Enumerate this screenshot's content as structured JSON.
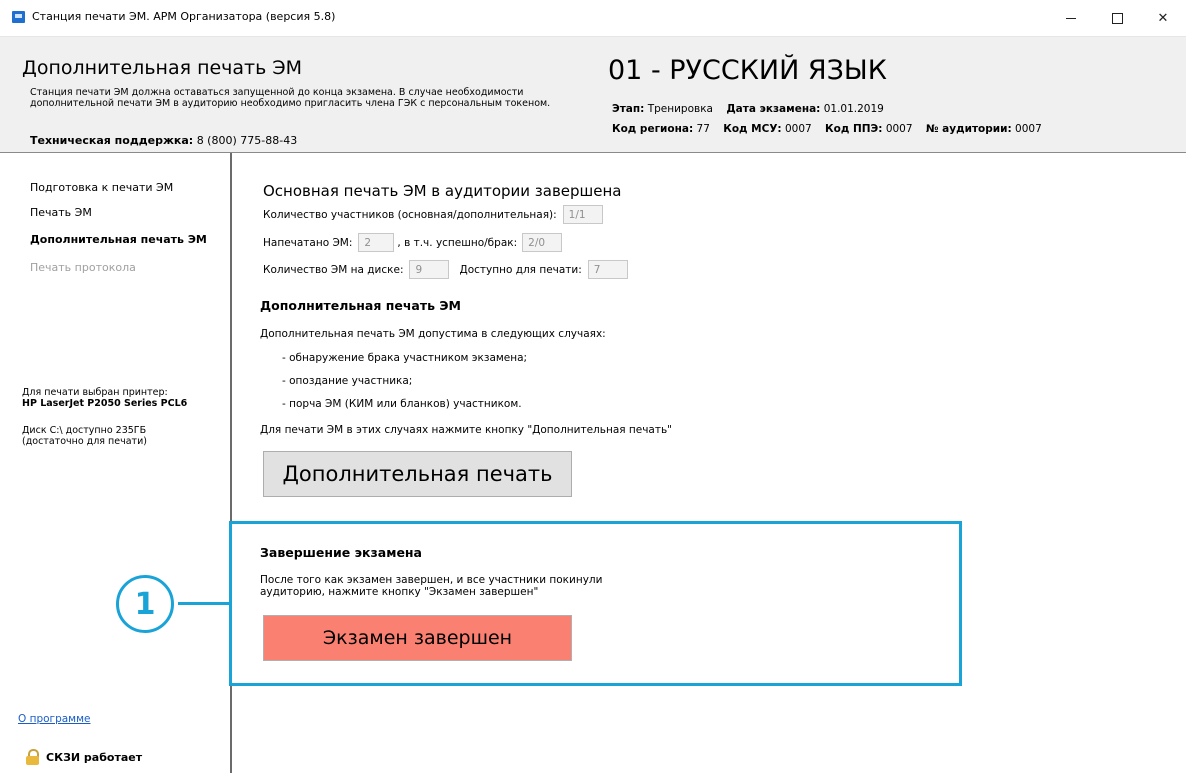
{
  "window": {
    "title": "Станция печати ЭМ. АРМ Организатора (версия 5.8)",
    "controls": {
      "minimize": "—",
      "maximize": "☐",
      "close": "✕"
    }
  },
  "header": {
    "title": "Дополнительная печать ЭМ",
    "description": "Станция печати ЭМ должна оставаться запущенной до конца экзамена. В случае необходимости дополнительной печати ЭМ в аудиторию необходимо пригласить члена ГЭК с персональным токеном.",
    "support_label": "Техническая поддержка:",
    "support_phone": "8 (800) 775-88-43",
    "subject": "01 - РУССКИЙ ЯЗЫК",
    "stage_label": "Этап:",
    "stage_value": "Тренировка",
    "exam_date_label": "Дата экзамена:",
    "exam_date_value": "01.01.2019",
    "region_label": "Код региона:",
    "region_value": "77",
    "msu_label": "Код МСУ:",
    "msu_value": "0007",
    "ppe_label": "Код ППЭ:",
    "ppe_value": "0007",
    "room_label": "№ аудитории:",
    "room_value": "0007"
  },
  "sidebar": {
    "items": [
      {
        "label": "Подготовка к печати ЭМ",
        "state": "normal"
      },
      {
        "label": "Печать ЭМ",
        "state": "normal"
      },
      {
        "label": "Дополнительная печать ЭМ",
        "state": "active"
      },
      {
        "label": "Печать протокола",
        "state": "disabled"
      }
    ],
    "printer_label": "Для печати выбран принтер:",
    "printer_name": "HP LaserJet P2050 Series PCL6",
    "disk_line1": "Диск C:\\ доступно 235ГБ",
    "disk_line2": "(достаточно для печати)",
    "about_link": "О программе",
    "skzi_status": "СКЗИ работает"
  },
  "main": {
    "section_title": "Основная печать ЭМ в аудитории завершена",
    "participants_label": "Количество участников (основная/дополнительная):",
    "participants_value": "1/1",
    "printed_label": "Напечатано ЭМ:",
    "printed_value": "2",
    "success_label": ", в т.ч. успешно/брак:",
    "success_value": "2/0",
    "disk_count_label": "Количество ЭМ на диске:",
    "disk_count_value": "9",
    "available_label": "Доступно для печати:",
    "available_value": "7",
    "extra_title": "Дополнительная печать ЭМ",
    "extra_intro": "Дополнительная печать ЭМ допустима в следующих случаях:",
    "cases": [
      "- обнаружение брака участником экзамена;",
      "- опоздание участника;",
      "- порча ЭМ (КИМ или бланков) участником."
    ],
    "extra_hint": "Для печати ЭМ в этих случаях нажмите кнопку \"Дополнительная печать\"",
    "extra_button": "Дополнительная печать",
    "finish_title": "Завершение экзамена",
    "finish_desc": "После того как экзамен завершен, и все участники покинули аудиторию, нажмите кнопку \"Экзамен завершен\"",
    "finish_button": "Экзамен завершен"
  },
  "annotation": {
    "callout_number": "1"
  },
  "colors": {
    "accent": "#1aa3d6",
    "finish_button": "#fa8072",
    "header_bg": "#f0f0f0"
  }
}
